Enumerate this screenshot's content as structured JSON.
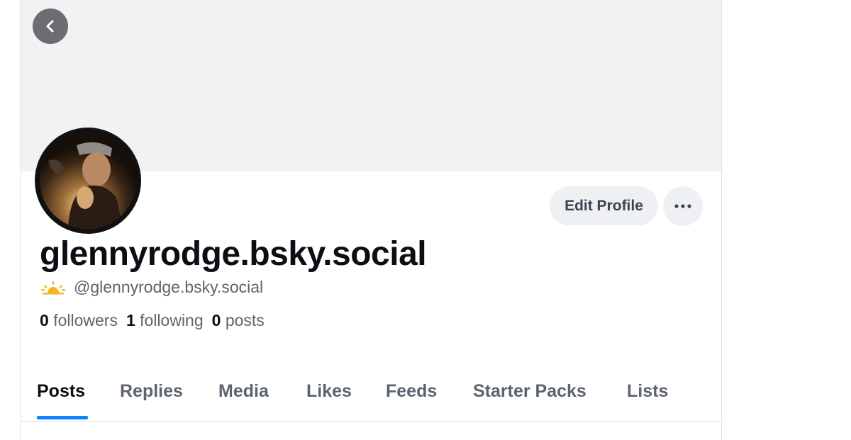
{
  "profile": {
    "display_name": "glennyrodge.bsky.social",
    "handle": "@glennyrodge.bsky.social"
  },
  "actions": {
    "edit_profile_label": "Edit Profile"
  },
  "stats": {
    "followers_count": "0",
    "followers_label": "followers",
    "following_count": "1",
    "following_label": "following",
    "posts_count": "0",
    "posts_label": "posts"
  },
  "tabs": [
    {
      "label": "Posts",
      "active": true
    },
    {
      "label": "Replies",
      "active": false
    },
    {
      "label": "Media",
      "active": false
    },
    {
      "label": "Likes",
      "active": false
    },
    {
      "label": "Feeds",
      "active": false
    },
    {
      "label": "Starter Packs",
      "active": false
    },
    {
      "label": "Lists",
      "active": false
    }
  ],
  "icons": {
    "back": "chevron-left-icon",
    "more": "ellipsis-icon",
    "handle_badge": "sunrise-icon"
  },
  "colors": {
    "accent": "#1083fe",
    "banner": "#f1f2f4",
    "badge": "#f5b623"
  }
}
